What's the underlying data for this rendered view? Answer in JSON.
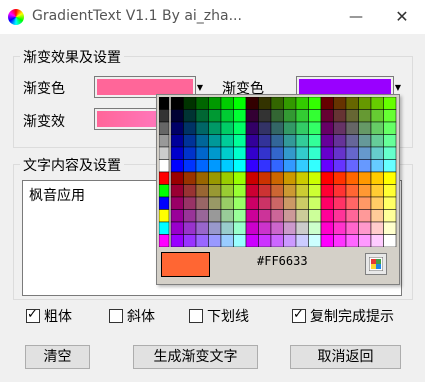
{
  "window": {
    "title": "GradientText V1.1 By ai_zha...",
    "minimize_symbol": "—",
    "close_symbol": "✕"
  },
  "gradient_settings": {
    "group_label": "渐变效果及设置",
    "color1_label": "渐变色",
    "color1_value": "#ff6699",
    "color2_label": "渐变色",
    "color2_value": "#9900ff",
    "effect_label": "渐变效",
    "effect_preview_from": "#ff6699",
    "effect_preview_to": "#ff77bb"
  },
  "text_content": {
    "group_label": "文字内容及设置",
    "text": "枫音应用"
  },
  "options": {
    "bold_label": "粗体",
    "bold_checked": true,
    "italic_label": "斜体",
    "italic_checked": false,
    "underline_label": "下划线",
    "underline_checked": false,
    "copy_hint_label": "复制完成提示",
    "copy_hint_checked": true
  },
  "buttons": {
    "clear": "清空",
    "generate": "生成渐变文字",
    "cancel": "取消返回"
  },
  "color_popup": {
    "selected_color": "#FF6633",
    "hex_text": "#FF6633"
  }
}
